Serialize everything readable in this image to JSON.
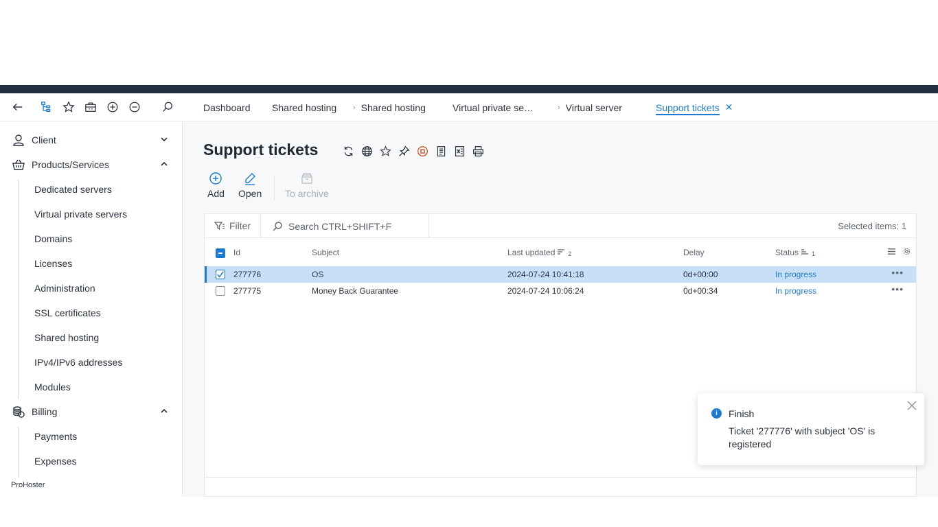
{
  "toolbar": {
    "icons": [
      "back-arrow-icon",
      "tree-menu-icon",
      "star-icon",
      "briefcase-icon",
      "zoom-in-icon",
      "zoom-out-icon",
      "search-icon"
    ]
  },
  "tabs": [
    {
      "label": "Dashboard",
      "chevron": false
    },
    {
      "label": "Shared hosting",
      "chevron": false
    },
    {
      "label": "Shared hosting",
      "chevron": true
    },
    {
      "label": "Virtual private se…",
      "chevron": false
    },
    {
      "label": "Virtual server",
      "chevron": true
    },
    {
      "label": "Support tickets",
      "chevron": false,
      "active": true
    }
  ],
  "sidebar": {
    "client": "Client",
    "products": "Products/Services",
    "product_items": [
      "Dedicated servers",
      "Virtual private servers",
      "Domains",
      "Licenses",
      "Administration",
      "SSL certificates",
      "Shared hosting",
      "IPv4/IPv6 addresses",
      "Modules"
    ],
    "billing": "Billing",
    "billing_items": [
      "Payments",
      "Expenses"
    ],
    "brand": "ProHoster"
  },
  "page": {
    "title": "Support tickets"
  },
  "actions": {
    "add": "Add",
    "open": "Open",
    "archive": "To archive"
  },
  "grid": {
    "filter_label": "Filter",
    "search_placeholder": "Search CTRL+SHIFT+F",
    "selected_info": "Selected items: 1",
    "columns": {
      "id": "Id",
      "subject": "Subject",
      "last_updated": "Last updated",
      "last_updated_sort": "2",
      "delay": "Delay",
      "status": "Status",
      "status_sort": "1"
    },
    "rows": [
      {
        "id": "277776",
        "subject": "OS",
        "last_updated": "2024-07-24 10:41:18",
        "delay": "0d+00:00",
        "status": "In progress",
        "selected": true
      },
      {
        "id": "277775",
        "subject": "Money Back Guarantee",
        "last_updated": "2024-07-24 10:06:24",
        "delay": "0d+00:34",
        "status": "In progress",
        "selected": false
      }
    ]
  },
  "toast": {
    "title": "Finish",
    "message": "Ticket '277776' with subject 'OS' is registered"
  },
  "colors": {
    "accent": "#1c7bd1",
    "topbar": "#233040",
    "selected_row": "#c7dff7"
  }
}
